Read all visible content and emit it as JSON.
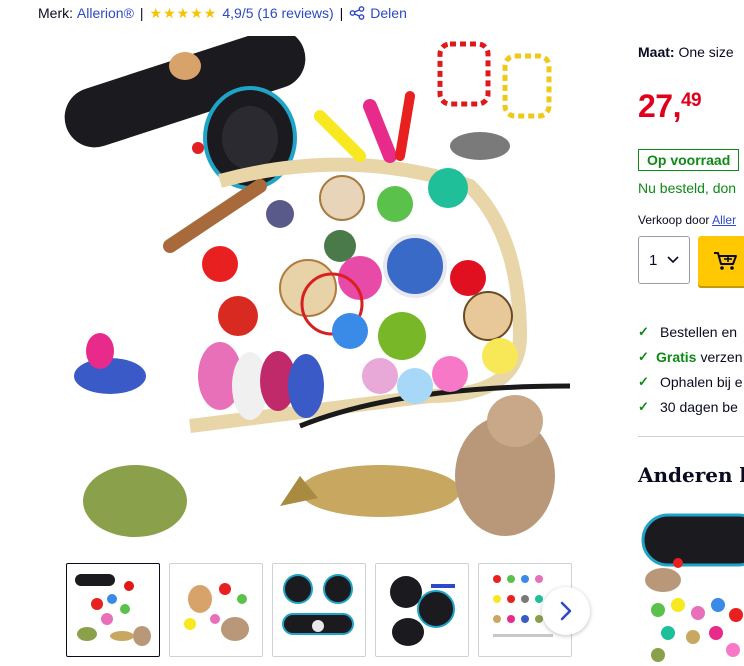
{
  "meta": {
    "brand_label": "Merk:",
    "brand_name": "Allerion®",
    "separator": "|",
    "rating_text": "4,9/5 (16 reviews)",
    "stars": 5,
    "share_label": "Delen"
  },
  "gallery": {
    "thumbnail_count": 5,
    "active_index": 0
  },
  "buybox": {
    "size_label": "Maat:",
    "size_value": "One size",
    "price_whole": "27,",
    "price_cents": "49",
    "stock_label": "Op voorraad",
    "delivery_text": "Nu besteld, don",
    "seller_label": "Verkoop door",
    "seller_name": "Aller",
    "quantity": "1"
  },
  "usps": [
    {
      "strong": "",
      "text": "Bestellen en"
    },
    {
      "strong": "Gratis",
      "text": "verzen"
    },
    {
      "strong": "",
      "text": "Ophalen bij e"
    },
    {
      "strong": "",
      "text": "30 dagen be"
    }
  ],
  "others": {
    "title": "Anderen be"
  },
  "colors": {
    "link": "#2d49c6",
    "price": "#e0001b",
    "stock": "#0e8a16",
    "cart_button": "#ffc800",
    "star": "#f5c300"
  }
}
